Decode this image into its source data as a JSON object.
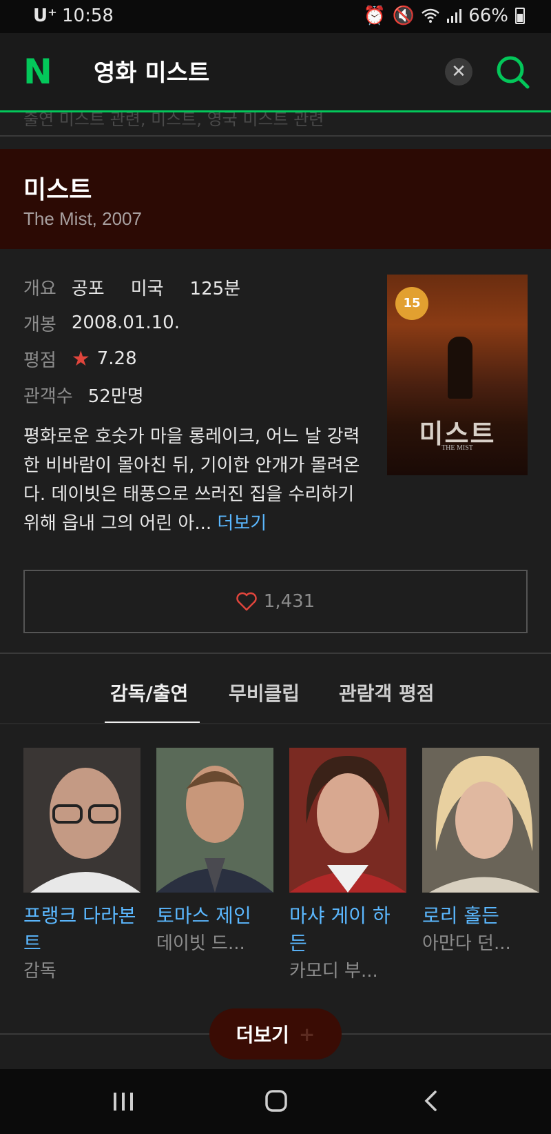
{
  "status_bar": {
    "carrier": "U⁺",
    "time": "10:58",
    "battery": "66%"
  },
  "search": {
    "logo": "N",
    "query": "영화 미스트"
  },
  "hidden_row_text": "출연   미스트 관련, 미스트, 영국 미스트 관련",
  "movie": {
    "title": "미스트",
    "subtitle": "The Mist, 2007",
    "overview_label": "개요",
    "genre": "공포",
    "country": "미국",
    "runtime": "125분",
    "release_label": "개봉",
    "release_date": "2008.01.10.",
    "rating_label": "평점",
    "rating": "7.28",
    "audience_label": "관객수",
    "audience": "52만명",
    "synopsis": "평화로운 호숫가 마을 롱레이크, 어느 날 강력한 비바람이 몰아친 뒤, 기이한 안개가 몰려온다. 데이빗은 태풍으로 쓰러진 집을 수리하기 위해 읍내 그의 어린 아... ",
    "more_link": "더보기",
    "poster": {
      "age_badge": "15",
      "title": "미스트",
      "subtitle": "THE MIST"
    }
  },
  "likes": "1,431",
  "tabs": [
    "감독/출연",
    "무비클립",
    "관람객 평점"
  ],
  "cast": [
    {
      "name": "프랭크 다라본트",
      "role": "감독"
    },
    {
      "name": "토마스 제인",
      "role": "데이빗 드..."
    },
    {
      "name": "마샤 게이 하든",
      "role": "카모디 부..."
    },
    {
      "name": "로리 홀든",
      "role": "아만다 던..."
    }
  ],
  "more_button": "더보기",
  "colors": {
    "naver_green": "#03c75a",
    "link_blue": "#5bb8ff",
    "title_bg": "#2c0a04",
    "rating_star": "#e0453c"
  }
}
